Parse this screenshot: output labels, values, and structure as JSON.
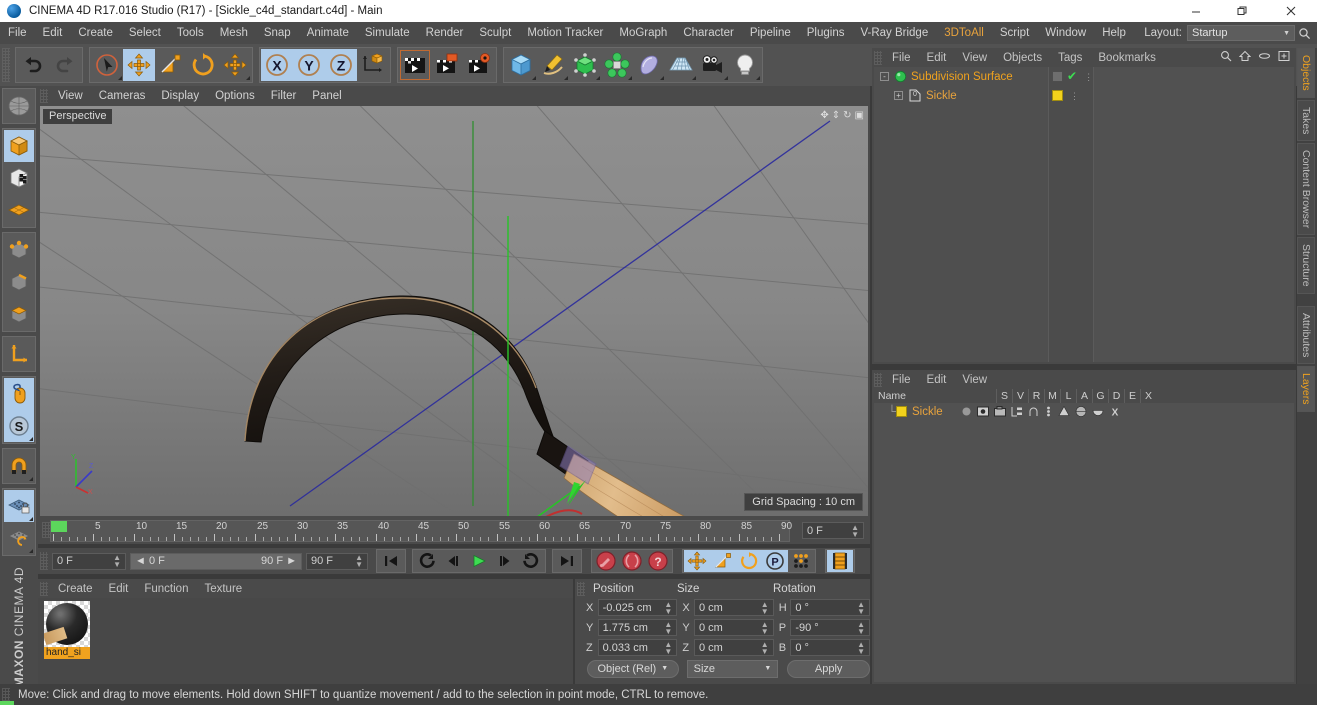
{
  "window": {
    "title": "CINEMA 4D R17.016 Studio (R17) - [Sickle_c4d_standart.c4d] - Main",
    "minimize": "—",
    "maximize": "❐",
    "close": "✕"
  },
  "menubar": {
    "items": [
      "File",
      "Edit",
      "Create",
      "Select",
      "Tools",
      "Mesh",
      "Snap",
      "Animate",
      "Simulate",
      "Render",
      "Sculpt",
      "Motion Tracker",
      "MoGraph",
      "Character",
      "Pipeline",
      "Plugins",
      "V-Ray Bridge",
      "3DToAll",
      "Script",
      "Window",
      "Help"
    ],
    "accent_items": [
      "3DToAll"
    ],
    "layout_label": "Layout:",
    "layout_value": "Startup",
    "search_icon": "search-icon"
  },
  "toolbar": {
    "groups": [
      {
        "name": "history",
        "buttons": [
          {
            "name": "undo-button",
            "icon": "undo-icon",
            "selected": false
          },
          {
            "name": "redo-button",
            "icon": "redo-icon",
            "selected": false
          }
        ]
      },
      {
        "name": "selection-modes",
        "buttons": [
          {
            "name": "live-selection-tool",
            "icon": "cursor-icon",
            "selected": false
          },
          {
            "name": "move-tool",
            "icon": "move-icon",
            "selected": true
          },
          {
            "name": "scale-tool",
            "icon": "scale-icon",
            "selected": false
          },
          {
            "name": "rotate-tool",
            "icon": "rotate-icon",
            "selected": false
          },
          {
            "name": "move-dupe-tool",
            "icon": "move-icon",
            "selected": false
          }
        ]
      },
      {
        "name": "axis-locks",
        "buttons": [
          {
            "name": "lock-x-axis",
            "icon": "x-axis-icon",
            "selected": true
          },
          {
            "name": "lock-y-axis",
            "icon": "y-axis-icon",
            "selected": true
          },
          {
            "name": "lock-z-axis",
            "icon": "z-axis-icon",
            "selected": true
          },
          {
            "name": "world-object-coordinates",
            "icon": "world-axis-icon",
            "selected": false
          }
        ]
      },
      {
        "name": "render",
        "buttons": [
          {
            "name": "render-view-button",
            "icon": "clapper-icon",
            "selected": false
          },
          {
            "name": "render-to-picture-viewer-button",
            "icon": "clapper-picture-icon",
            "selected": false
          },
          {
            "name": "edit-render-settings-button",
            "icon": "clapper-gear-icon",
            "selected": false
          }
        ]
      },
      {
        "name": "create",
        "buttons": [
          {
            "name": "add-cube-button",
            "icon": "cube-icon",
            "selected": false
          },
          {
            "name": "add-spline-button",
            "icon": "pen-icon",
            "selected": false
          },
          {
            "name": "add-nurbs-button",
            "icon": "green-cube-icon",
            "selected": false
          },
          {
            "name": "add-mograph-button",
            "icon": "cloner-icon",
            "selected": false
          },
          {
            "name": "add-deformer-button",
            "icon": "bend-icon",
            "selected": false
          },
          {
            "name": "add-scene-button",
            "icon": "floor-icon",
            "selected": false
          },
          {
            "name": "add-camera-button",
            "icon": "camera-icon",
            "selected": false
          },
          {
            "name": "add-light-button",
            "icon": "light-bulb-icon",
            "selected": false
          }
        ]
      }
    ]
  },
  "lefttool": {
    "buttons": [
      {
        "name": "make-editable-button",
        "icon": "make-editable-icon",
        "selected": false
      },
      {
        "name": "model-mode-button",
        "icon": "model-cube-icon",
        "selected": true
      },
      {
        "name": "texture-mode-button",
        "icon": "texture-cube-icon",
        "selected": false
      },
      {
        "name": "workplane-mode-button",
        "icon": "workplane-icon",
        "selected": false
      },
      {
        "name": "points-mode-button",
        "icon": "points-icon",
        "selected": false
      },
      {
        "name": "edges-mode-button",
        "icon": "edges-icon",
        "selected": false
      },
      {
        "name": "polygons-mode-button",
        "icon": "polygons-icon",
        "selected": false
      },
      {
        "name": "enable-axis-button",
        "icon": "axis-icon",
        "selected": false
      },
      {
        "name": "viewport-solo-button",
        "icon": "mouse-icon",
        "selected": true
      },
      {
        "name": "enable-snap-button",
        "icon": "snap-s-icon",
        "selected": true
      },
      {
        "name": "magnet-tool-button",
        "icon": "magnet-icon",
        "selected": false
      },
      {
        "name": "workplane-lock-button",
        "icon": "workplane-lock-icon",
        "selected": true
      },
      {
        "name": "planar-workplane-button",
        "icon": "planar-rotate-icon",
        "selected": false
      }
    ],
    "brand_top": "MAXON",
    "brand_bottom": "CINEMA 4D"
  },
  "viewport": {
    "menu": [
      "View",
      "Cameras",
      "Display",
      "Options",
      "Filter",
      "Panel"
    ],
    "label": "Perspective",
    "grid_spacing": "Grid Spacing : 10 cm",
    "axis_gizmo": "xyz-axis-gizmo"
  },
  "timeline": {
    "ticks": [
      "0",
      "5",
      "10",
      "15",
      "20",
      "25",
      "30",
      "35",
      "40",
      "45",
      "50",
      "55",
      "60",
      "65",
      "70",
      "75",
      "80",
      "85",
      "90"
    ],
    "current_frame_marker": "0",
    "end_field": "0 F"
  },
  "transport": {
    "current_frame": "0 F",
    "range_start": "0 F",
    "range_end": "90 F",
    "max_frame": "90 F",
    "buttons": [
      {
        "name": "go-to-start-button",
        "icon": "skip-start-icon"
      },
      {
        "name": "go-back-keyframe-button",
        "icon": "prev-key-icon"
      },
      {
        "name": "step-back-button",
        "icon": "step-back-icon"
      },
      {
        "name": "play-button",
        "icon": "play-icon"
      },
      {
        "name": "step-forward-button",
        "icon": "step-forward-icon"
      },
      {
        "name": "go-forward-keyframe-button",
        "icon": "next-key-icon"
      },
      {
        "name": "go-to-end-button",
        "icon": "skip-end-icon"
      }
    ],
    "record_buttons": [
      {
        "name": "record-active-objects-button",
        "icon": "record-key-icon"
      },
      {
        "name": "autokeying-button",
        "icon": "autokey-icon"
      },
      {
        "name": "keyframe-selection-button",
        "icon": "keyframe-question-icon"
      }
    ],
    "key_toggles": [
      {
        "name": "position-key-toggle",
        "icon": "move-key-icon",
        "selected": true
      },
      {
        "name": "scale-key-toggle",
        "icon": "scale-key-icon",
        "selected": true
      },
      {
        "name": "rotation-key-toggle",
        "icon": "rotate-key-icon",
        "selected": true
      },
      {
        "name": "parameter-key-toggle",
        "icon": "param-p-icon",
        "selected": true
      },
      {
        "name": "point-level-animation-toggle",
        "icon": "pla-dots-icon",
        "selected": false
      }
    ],
    "timeline_toggle": {
      "name": "timeline-button",
      "icon": "timeline-icon",
      "selected": true
    }
  },
  "material_manager": {
    "menu": [
      "Create",
      "Edit",
      "Function",
      "Texture"
    ],
    "materials": [
      {
        "name": "hand_si",
        "icon": "material-sphere-preview"
      }
    ]
  },
  "coordinates": {
    "headers": [
      "Position",
      "Size",
      "Rotation"
    ],
    "rows": [
      {
        "pos_label": "X",
        "pos_value": "-0.025 cm",
        "size_label": "X",
        "size_value": "0 cm",
        "rot_label": "H",
        "rot_value": "0 °"
      },
      {
        "pos_label": "Y",
        "pos_value": "1.775 cm",
        "size_label": "Y",
        "size_value": "0 cm",
        "rot_label": "P",
        "rot_value": "-90 °"
      },
      {
        "pos_label": "Z",
        "pos_value": "0.033 cm",
        "size_label": "Z",
        "size_value": "0 cm",
        "rot_label": "B",
        "rot_value": "0 °"
      }
    ],
    "mode_dropdown": "Object (Rel)",
    "size_dropdown": "Size",
    "apply_button": "Apply"
  },
  "object_manager": {
    "menu": [
      "File",
      "Edit",
      "View",
      "Objects",
      "Tags",
      "Bookmarks"
    ],
    "tools": [
      "search-icon",
      "home-icon",
      "link-icon",
      "expand-icon"
    ],
    "items": [
      {
        "name": "Subdivision Surface",
        "type": "generator",
        "selected": true,
        "indent": 0,
        "icon": "subdivision-surface-icon",
        "tags": [
          "disabled-tag",
          "green-check-tag"
        ]
      },
      {
        "name": "Sickle",
        "type": "polygon-object",
        "selected": false,
        "indent": 1,
        "icon": "polygon-object-icon",
        "tags": [
          "yellow-material-tag"
        ]
      }
    ]
  },
  "attribute_manager": {
    "menu": [
      "File",
      "Edit",
      "View"
    ],
    "columns": [
      "Name",
      "S",
      "V",
      "R",
      "M",
      "L",
      "A",
      "G",
      "D",
      "E",
      "X"
    ],
    "rows": [
      {
        "name": "Sickle",
        "icon": "yellow-layer-swatch",
        "cells": [
          "dot-icon",
          "display-icon",
          "render-icon",
          "manager-icon",
          "lock-icon",
          "animation-icon",
          "generator-icon",
          "deformer-icon",
          "expression-icon",
          "xpresso-icon"
        ]
      }
    ]
  },
  "vertical_tabs": {
    "top": [
      {
        "label": "Objects",
        "active": true
      },
      {
        "label": "Takes",
        "active": false
      },
      {
        "label": "Content Browser",
        "active": false
      },
      {
        "label": "Structure",
        "active": false
      }
    ],
    "bottom": [
      {
        "label": "Attributes",
        "active": false
      },
      {
        "label": "Layers",
        "active": true
      }
    ]
  },
  "statusbar": {
    "text": "Move: Click and drag to move elements. Hold down SHIFT to quantize movement / add to the selection in point mode, CTRL to remove."
  },
  "colors": {
    "accent_orange": "#e8a33d",
    "selected_blue": "#aeccea",
    "panel_bg": "#4a4a4a",
    "toolbar_bg": "#525252",
    "green_axis": "#1ec41e",
    "red_axis": "#e02020",
    "blue_axis": "#2020e0",
    "material_label": "#f0a21e"
  }
}
